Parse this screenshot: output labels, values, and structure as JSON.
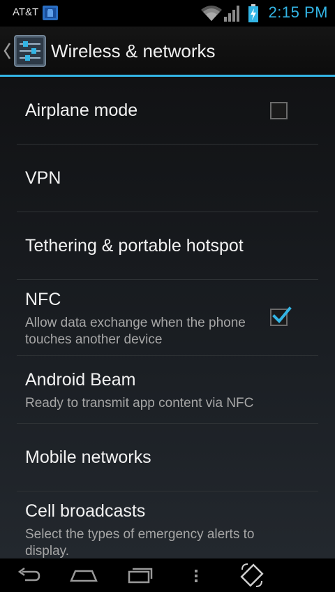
{
  "status_bar": {
    "carrier": "AT&T",
    "time": "2:15 PM",
    "icons": [
      "notification-icon",
      "wifi-icon",
      "signal-icon",
      "battery-charging-icon"
    ],
    "time_color": "#33b5e5"
  },
  "action_bar": {
    "title": "Wireless & networks",
    "icon": "settings-sliders-icon",
    "accent_color": "#33b5e5"
  },
  "settings": {
    "items": [
      {
        "title": "Airplane mode",
        "checkbox": true,
        "checked": false
      },
      {
        "title": "VPN"
      },
      {
        "title": "Tethering & portable hotspot"
      },
      {
        "title": "NFC",
        "summary": "Allow data exchange when the phone touches another device",
        "checkbox": true,
        "checked": true
      },
      {
        "title": "Android Beam",
        "summary": "Ready to transmit app content via NFC"
      },
      {
        "title": "Mobile networks"
      },
      {
        "title": "Cell broadcasts",
        "summary": "Select the types of emergency alerts to display."
      }
    ]
  },
  "nav_bar": {
    "buttons": [
      "back-icon",
      "home-icon",
      "recent-apps-icon",
      "menu-icon",
      "rotate-icon"
    ]
  }
}
